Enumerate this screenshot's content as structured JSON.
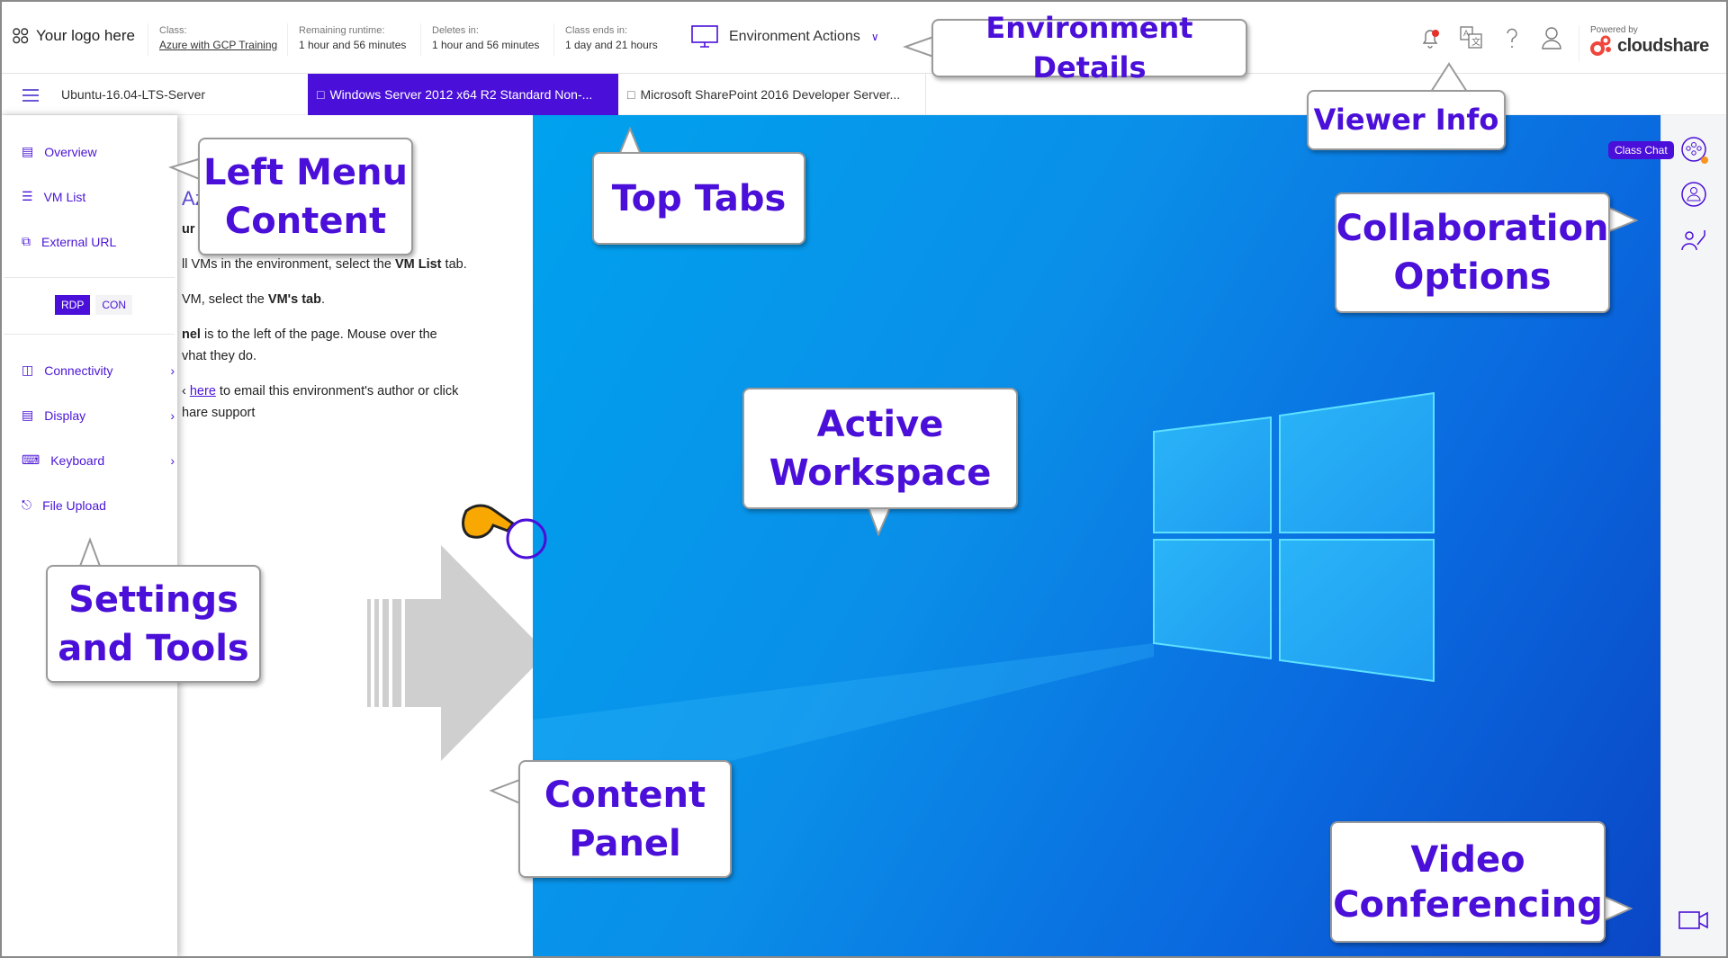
{
  "topbar": {
    "logo": "Your logo here",
    "class_label": "Class:",
    "class_value": "Azure with GCP Training",
    "runtime_label": "Remaining runtime:",
    "runtime_value": "1 hour and 56 minutes",
    "deletes_label": "Deletes in:",
    "deletes_value": "1 hour and 56 minutes",
    "ends_label": "Class ends in:",
    "ends_value": "1 day and 21 hours",
    "env_actions": "Environment Actions",
    "powered_by": "Powered by",
    "brand": "cloudshare",
    "icons": [
      "bell-icon",
      "translate-icon",
      "help-icon",
      "user-icon"
    ]
  },
  "tabs": [
    {
      "label": "Ubuntu-16.04-LTS-Server",
      "active": false
    },
    {
      "label": "Windows Server 2012 x64 R2 Standard Non-...",
      "active": true
    },
    {
      "label": "Microsoft SharePoint 2016 Developer Server...",
      "active": false
    }
  ],
  "menu": {
    "items": [
      "Overview",
      "VM List",
      "External URL"
    ],
    "rdp": "RDP",
    "con": "CON",
    "tools": [
      "Connectivity",
      "Display",
      "Keyboard",
      "File Upload"
    ]
  },
  "content": {
    "heading": "Az",
    "sub": "ur",
    "l1a": "ll VMs in the environment, select the ",
    "l1b": "VM List",
    "l1c": " tab.",
    "l2a": "VM, select the ",
    "l2b": "VM's tab",
    ".l2c": ".",
    "l3a": "nel",
    " l3b": " is to the left of the page. Mouse over the",
    "l4": "vhat they do.",
    "l5a": "here",
    "l5b": " to email this environment's author or click",
    "l6": "hare support"
  },
  "rail": {
    "class_chat": "Class Chat"
  },
  "callouts": {
    "env_details": "Environment Details",
    "viewer_info": "Viewer Info",
    "left_menu_1": "Left Menu",
    "left_menu_2": "Content",
    "top_tabs": "Top Tabs",
    "collab_1": "Collaboration",
    "collab_2": "Options",
    "workspace_1": "Active",
    "workspace_2": "Workspace",
    "settings_1": "Settings",
    "settings_2": "and Tools",
    "content_1": "Content",
    "content_2": "Panel",
    "video_1": "Video",
    "video_2": "Conferencing"
  },
  "colors": {
    "accent": "#4a0fd8",
    "brand": "#f0463c",
    "callout_text": "#4a0fd8"
  }
}
